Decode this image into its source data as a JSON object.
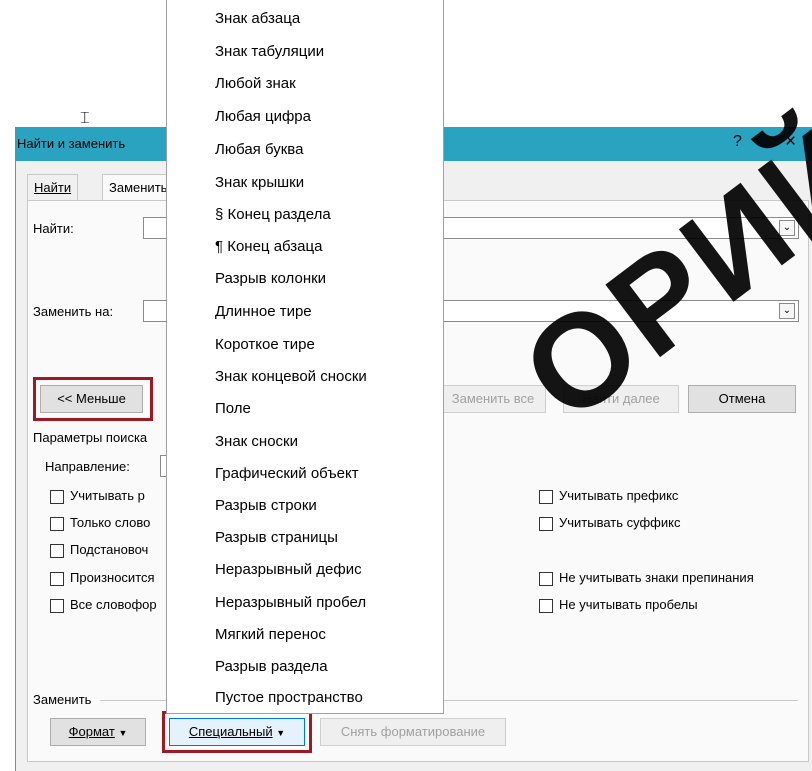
{
  "dialog": {
    "title": "Найти и заменить",
    "help": "?",
    "close": "×",
    "tabs": [
      {
        "label": "Найти"
      },
      {
        "label": "Заменить"
      }
    ],
    "find_label": "Найти:",
    "replace_label": "Заменить на:",
    "less_button": "<< Меньше",
    "replace_all_button": "Заменить все",
    "find_next_button": "Найти далее",
    "cancel_button": "Отмена",
    "search_options_label": "Параметры поиска",
    "direction_label": "Направление:",
    "options_left": [
      {
        "label": "Учитывать р",
        "checked": false
      },
      {
        "label": "Только слово",
        "checked": false
      },
      {
        "label": "Подстановоч",
        "checked": false
      },
      {
        "label": "Произносится",
        "checked": false
      },
      {
        "label": "Все словофор",
        "checked": false
      }
    ],
    "options_right": [
      {
        "label": "Учитывать префикс",
        "checked": false
      },
      {
        "label": "Учитывать суффикс",
        "checked": false
      },
      {
        "label": "Не учитывать знаки препинания",
        "checked": false
      },
      {
        "label": "Не учитывать пробелы",
        "checked": false
      }
    ],
    "replace_section_label": "Заменить",
    "format_button": "Формат",
    "special_button": "Специальный",
    "clear_format_button": "Снять форматирование"
  },
  "special_menu": {
    "items": [
      "Знак абзаца",
      "Знак табуляции",
      "Любой знак",
      "Любая цифра",
      "Любая буква",
      "Знак крышки",
      "§ Конец раздела",
      "¶ Конец абзаца",
      "Разрыв колонки",
      "Длинное тире",
      "Короткое тире",
      "Знак концевой сноски",
      "Поле",
      "Знак сноски",
      "Графический объект",
      "Разрыв строки",
      "Разрыв страницы",
      "Неразрывный дефис",
      "Неразрывный пробел",
      "Мягкий перенос",
      "Разрыв раздела",
      "Пустое пространство"
    ]
  },
  "watermark": "ОРИЙ БГУ",
  "colors": {
    "titlebar": "#2aa3c0",
    "highlight": "#9b1a24"
  }
}
